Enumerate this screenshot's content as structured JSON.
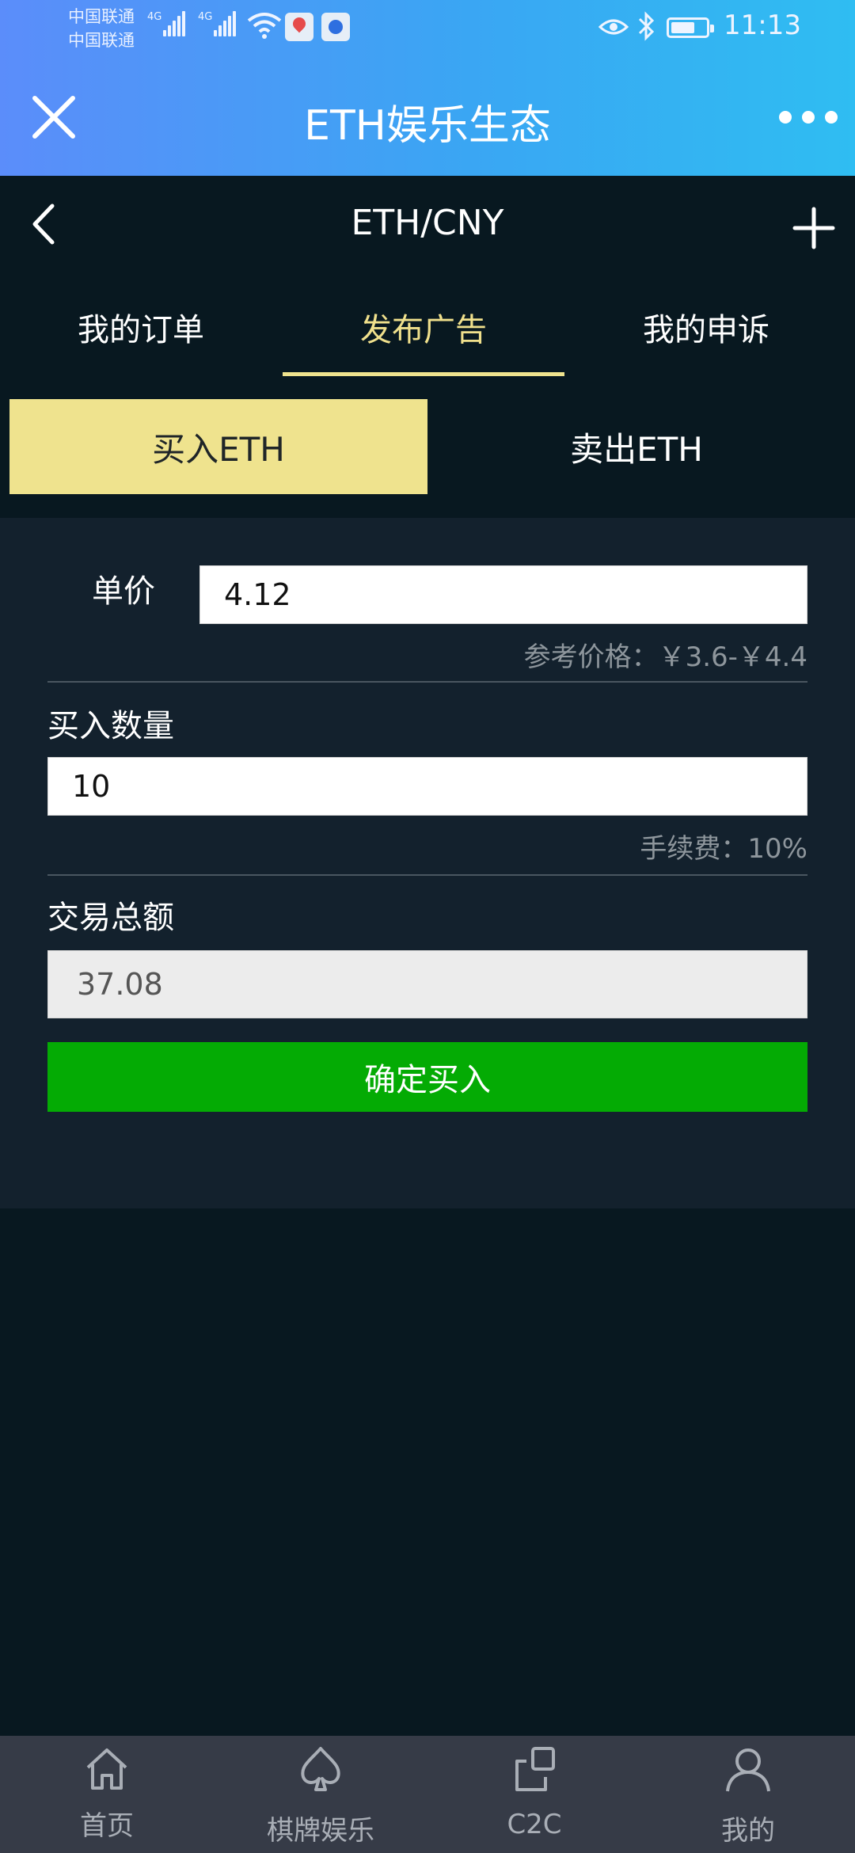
{
  "status_bar": {
    "carrier_1": "中国联通",
    "carrier_2": "中国联通",
    "network_1": "4G",
    "network_2": "4G",
    "time": "11:13",
    "battery_level": 0.7,
    "icons": [
      "signal-icon",
      "wifi-icon",
      "app-notification-icon",
      "baidu-icon",
      "eye-comfort-icon",
      "bluetooth-icon",
      "battery-icon"
    ]
  },
  "titlebar": {
    "title": "ETH娱乐生态",
    "icons": {
      "close": "close-icon",
      "more": "more-dots-icon"
    }
  },
  "header": {
    "pair": "ETH/CNY",
    "icons": {
      "back": "chevron-left-icon",
      "add": "plus-icon"
    }
  },
  "tabs": [
    {
      "label": "我的订单",
      "active": false
    },
    {
      "label": "发布广告",
      "active": true
    },
    {
      "label": "我的申诉",
      "active": false
    }
  ],
  "segment": {
    "buy_label": "买入ETH",
    "sell_label": "卖出ETH",
    "selected": "buy"
  },
  "form": {
    "price_label": "单价",
    "price_value": "4.12",
    "price_reference": "参考价格：￥3.6-￥4.4",
    "quantity_label": "买入数量",
    "quantity_value": "10",
    "fee_hint": "手续费：10%",
    "total_label": "交易总额",
    "total_value": "37.08",
    "confirm_label": "确定买入"
  },
  "bottom_nav": [
    {
      "label": "首页",
      "icon": "home-icon"
    },
    {
      "label": "棋牌娱乐",
      "icon": "spade-icon"
    },
    {
      "label": "C2C",
      "icon": "c2c-icon"
    },
    {
      "label": "我的",
      "icon": "user-icon"
    }
  ],
  "colors": {
    "background": "#081820",
    "panel": "#13212d",
    "accent": "#efe38e",
    "confirm": "#04ab04",
    "bottom_bar": "#363b47"
  }
}
